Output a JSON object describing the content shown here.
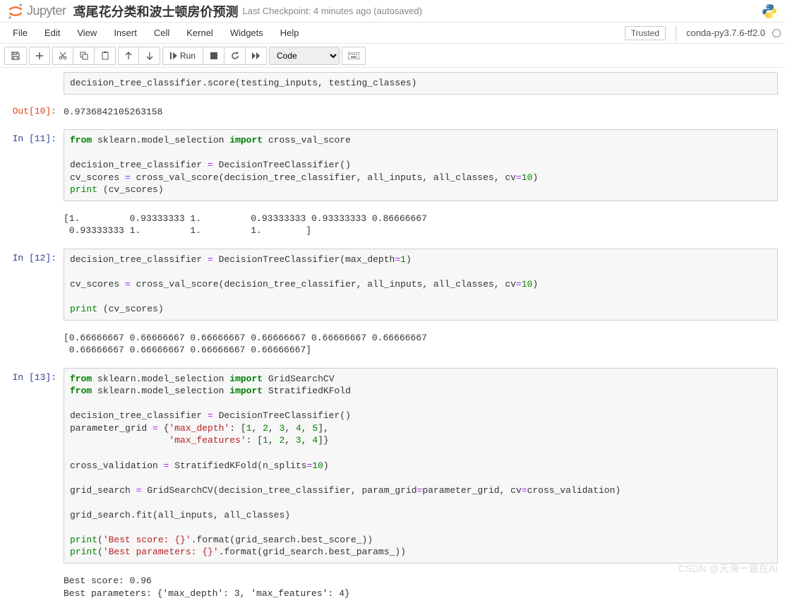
{
  "header": {
    "logo_text": "Jupyter",
    "title": "鸢尾花分类和波士顿房价预测",
    "checkpoint": "Last Checkpoint: 4 minutes ago  (autosaved)"
  },
  "menu": {
    "file": "File",
    "edit": "Edit",
    "view": "View",
    "insert": "Insert",
    "cell": "Cell",
    "kernel": "Kernel",
    "widgets": "Widgets",
    "help": "Help",
    "trusted": "Trusted",
    "kernel_name": "conda-py3.7.6-tf2.0"
  },
  "toolbar": {
    "run_label": "Run",
    "cell_type": "Code"
  },
  "cells": [
    {
      "exec": "10",
      "code_html": "decision_tree_classifier.score(testing_inputs, testing_classes)",
      "out_label": "Out[10]:",
      "output": "0.9736842105263158"
    },
    {
      "exec": "11",
      "code_html": "<span class='kw-green'>from</span> sklearn.model_selection <span class='kw-green'>import</span> cross_val_score\n\ndecision_tree_classifier <span class='op'>=</span> DecisionTreeClassifier()\ncv_scores <span class='op'>=</span> cross_val_score(decision_tree_classifier, all_inputs, all_classes, cv<span class='op'>=</span><span class='num'>10</span>)\n<span class='name-builtin'>print</span> (cv_scores)",
      "output": "[1.         0.93333333 1.         0.93333333 0.93333333 0.86666667\n 0.93333333 1.         1.         1.        ]"
    },
    {
      "exec": "12",
      "code_html": "decision_tree_classifier <span class='op'>=</span> DecisionTreeClassifier(max_depth<span class='op'>=</span><span class='num'>1</span>)\n\ncv_scores <span class='op'>=</span> cross_val_score(decision_tree_classifier, all_inputs, all_classes, cv<span class='op'>=</span><span class='num'>10</span>)\n\n<span class='name-builtin'>print</span> (cv_scores)",
      "output": "[0.66666667 0.66666667 0.66666667 0.66666667 0.66666667 0.66666667\n 0.66666667 0.66666667 0.66666667 0.66666667]"
    },
    {
      "exec": "13",
      "code_html": "<span class='kw-green'>from</span> sklearn.model_selection <span class='kw-green'>import</span> GridSearchCV\n<span class='kw-green'>from</span> sklearn.model_selection <span class='kw-green'>import</span> StratifiedKFold\n\ndecision_tree_classifier <span class='op'>=</span> DecisionTreeClassifier()\nparameter_grid <span class='op'>=</span> {<span class='str'>'max_depth'</span>: [<span class='num'>1</span>, <span class='num'>2</span>, <span class='num'>3</span>, <span class='num'>4</span>, <span class='num'>5</span>],\n                  <span class='str'>'max_features'</span>: [<span class='num'>1</span>, <span class='num'>2</span>, <span class='num'>3</span>, <span class='num'>4</span>]}\n\ncross_validation <span class='op'>=</span> StratifiedKFold(n_splits<span class='op'>=</span><span class='num'>10</span>)\n\ngrid_search <span class='op'>=</span> GridSearchCV(decision_tree_classifier, param_grid<span class='op'>=</span>parameter_grid, cv<span class='op'>=</span>cross_validation)\n\ngrid_search.fit(all_inputs, all_classes)\n\n<span class='name-builtin'>print</span>(<span class='str'>'Best score: {}'</span>.format(grid_search.best_score_))\n<span class='name-builtin'>print</span>(<span class='str'>'Best parameters: {}'</span>.format(grid_search.best_params_))",
      "output": "Best score: 0.96\nBest parameters: {'max_depth': 3, 'max_features': 4}"
    }
  ],
  "watermark": "CSDN @天海一直在AI"
}
